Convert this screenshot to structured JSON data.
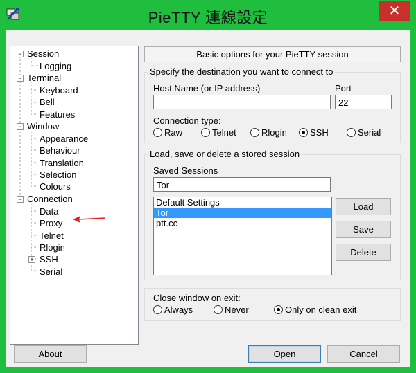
{
  "window": {
    "title": "PieTTY 連線設定",
    "close_glyph": "✕"
  },
  "tree": {
    "session": "Session",
    "logging": "Logging",
    "terminal": "Terminal",
    "keyboard": "Keyboard",
    "bell": "Bell",
    "features": "Features",
    "window": "Window",
    "appearance": "Appearance",
    "behaviour": "Behaviour",
    "translation": "Translation",
    "selection": "Selection",
    "colours": "Colours",
    "connection": "Connection",
    "data": "Data",
    "proxy": "Proxy",
    "telnet": "Telnet",
    "rlogin": "Rlogin",
    "ssh": "SSH",
    "serial": "Serial",
    "expanded_glyph": "−",
    "collapsed_glyph": "+",
    "annotation_color": "#e02020"
  },
  "panel": {
    "header": "Basic options for your PieTTY session",
    "destination": {
      "group_title": "Specify the destination you want to connect to",
      "host_label": "Host Name (or IP address)",
      "host_value": "",
      "port_label": "Port",
      "port_value": "22",
      "conn_type_label": "Connection type:",
      "conn_types": [
        "Raw",
        "Telnet",
        "Rlogin",
        "SSH",
        "Serial"
      ],
      "selected_conn_type": "SSH"
    },
    "sessions": {
      "group_title": "Load, save or delete a stored session",
      "saved_label": "Saved Sessions",
      "saved_value": "Tor",
      "list": [
        "Default Settings",
        "Tor",
        "ptt.cc"
      ],
      "selected_item": "Tor",
      "load": "Load",
      "save": "Save",
      "delete": "Delete"
    },
    "close_on_exit": {
      "group_title": "Close window on exit:",
      "options": [
        "Always",
        "Never",
        "Only on clean exit"
      ],
      "selected": "Only on clean exit"
    }
  },
  "buttons": {
    "about": "About",
    "open": "Open",
    "cancel": "Cancel"
  }
}
